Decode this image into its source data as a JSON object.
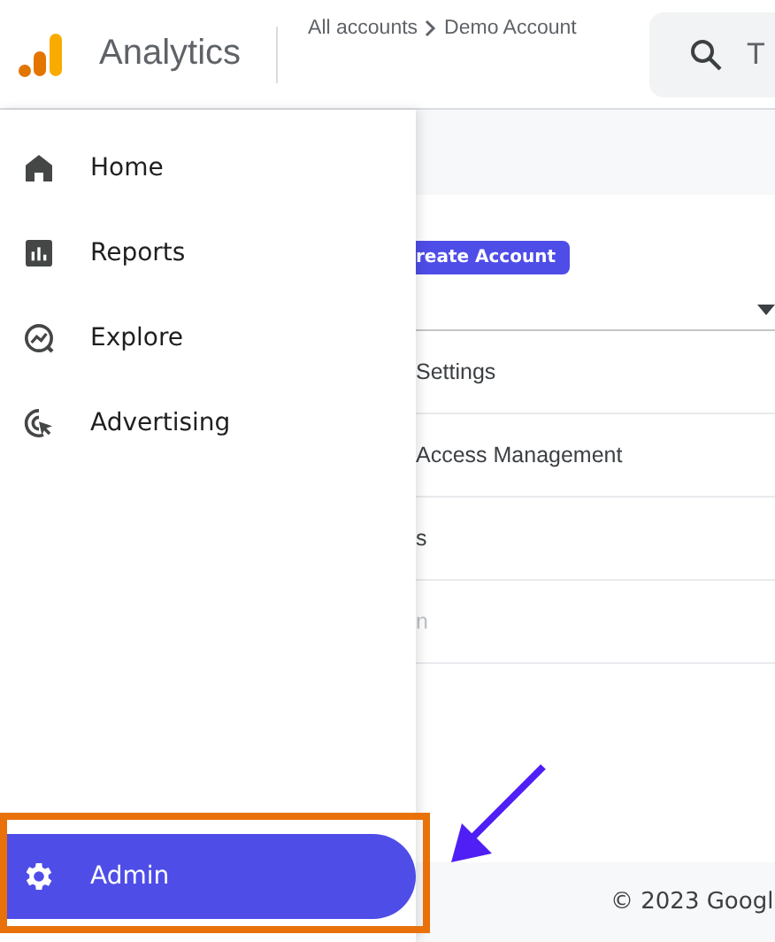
{
  "header": {
    "product": "Analytics",
    "breadcrumb": [
      "All accounts",
      "Demo Account"
    ],
    "search": {
      "placeholder": "T"
    }
  },
  "sidebar": {
    "items": [
      {
        "label": "Home",
        "kind": "home",
        "selected": false
      },
      {
        "label": "Reports",
        "kind": "reports",
        "selected": false
      },
      {
        "label": "Explore",
        "kind": "explore",
        "selected": false
      },
      {
        "label": "Advertising",
        "kind": "advertising",
        "selected": false
      }
    ],
    "admin": {
      "label": "Admin",
      "selected": true
    }
  },
  "content": {
    "create_button": "reate Account",
    "rows": [
      {
        "label": "Settings",
        "disabled": false
      },
      {
        "label": "Access Management",
        "disabled": false
      },
      {
        "label": "s",
        "disabled": false
      },
      {
        "label": "n",
        "disabled": true
      }
    ]
  },
  "footer": "© 2023 Googl"
}
